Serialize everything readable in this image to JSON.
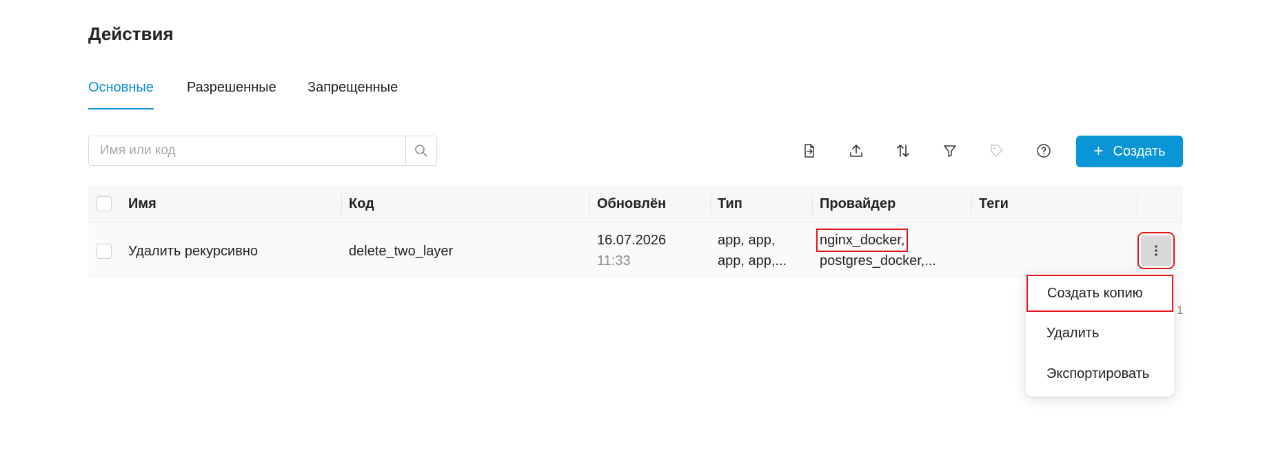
{
  "page": {
    "title": "Действия"
  },
  "tabs": [
    {
      "label": "Основные",
      "active": true
    },
    {
      "label": "Разрешенные",
      "active": false
    },
    {
      "label": "Запрещенные",
      "active": false
    }
  ],
  "search": {
    "placeholder": "Имя или код",
    "value": ""
  },
  "toolbar": {
    "tools": [
      {
        "icon": "import-file-icon"
      },
      {
        "icon": "upload-icon"
      },
      {
        "icon": "sort-icon"
      },
      {
        "icon": "filter-icon"
      },
      {
        "icon": "tag-icon",
        "disabled": true
      },
      {
        "icon": "help-icon"
      }
    ],
    "create_label": "Создать"
  },
  "table": {
    "columns": [
      "Имя",
      "Код",
      "Обновлён",
      "Тип",
      "Провайдер",
      "Теги"
    ],
    "rows": [
      {
        "name": "Удалить рекурсивно",
        "code": "delete_two_layer",
        "updated_date": "16.07.2026",
        "updated_time": "11:33",
        "type_line1": "app, app,",
        "type_line2": "app, app,...",
        "provider_line1": "nginx_docker,",
        "provider_line2": "postgres_docker,...",
        "tags": ""
      }
    ]
  },
  "context_menu": {
    "items": [
      "Создать копию",
      "Удалить",
      "Экспортировать"
    ]
  },
  "pagination_fragment": "1",
  "colors": {
    "accent": "#0a96d6",
    "tab_active": "#0a8ccf",
    "highlight": "#e0161a"
  }
}
